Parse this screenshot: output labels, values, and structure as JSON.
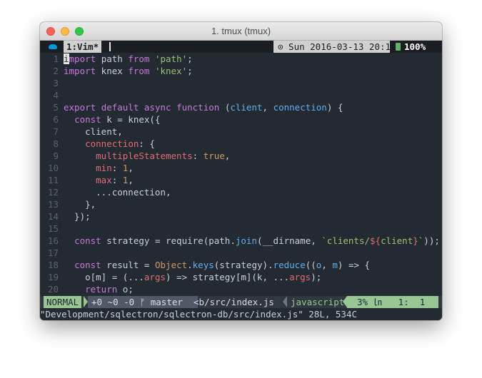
{
  "window": {
    "title": "1. tmux (tmux)"
  },
  "tmux": {
    "window_label": "1:Vim*",
    "datetime": "⊙ Sun 2016-03-13 20:12",
    "battery": "100%"
  },
  "code": {
    "lines": [
      {
        "n": "1",
        "t": "import path from 'path';"
      },
      {
        "n": "2",
        "t": "import knex from 'knex';"
      },
      {
        "n": "3",
        "t": ""
      },
      {
        "n": "4",
        "t": ""
      },
      {
        "n": "5",
        "t": "export default async function (client, connection) {"
      },
      {
        "n": "6",
        "t": "  const k = knex({"
      },
      {
        "n": "7",
        "t": "    client,"
      },
      {
        "n": "8",
        "t": "    connection: {"
      },
      {
        "n": "9",
        "t": "      multipleStatements: true,"
      },
      {
        "n": "10",
        "t": "      min: 1,"
      },
      {
        "n": "11",
        "t": "      max: 1,"
      },
      {
        "n": "12",
        "t": "      ...connection,"
      },
      {
        "n": "13",
        "t": "    },"
      },
      {
        "n": "14",
        "t": "  });"
      },
      {
        "n": "15",
        "t": ""
      },
      {
        "n": "16",
        "t": "  const strategy = require(path.join(__dirname, `clients/${client}`));"
      },
      {
        "n": "17",
        "t": ""
      },
      {
        "n": "18",
        "t": "  const result = Object.keys(strategy).reduce((o, m) => {"
      },
      {
        "n": "19",
        "t": "    o[m] = (...args) => strategy[m](k, ...args);"
      },
      {
        "n": "20",
        "t": "    return o;"
      }
    ]
  },
  "statusline": {
    "mode": "NORMAL",
    "git": "+0 ~0 -0 ᚠ master",
    "file": "<b/src/index.js",
    "filetype": "javascript",
    "position": "3% ㏑   1:  1"
  },
  "cmdline": "\"Development/sqlectron/sqlectron-db/src/index.js\" 28L, 534C",
  "colors": {
    "background": "#242a32",
    "keyword": "#c678dd",
    "string": "#98c379",
    "property": "#e06c75",
    "function": "#61afef",
    "mode_green": "#99c794"
  }
}
